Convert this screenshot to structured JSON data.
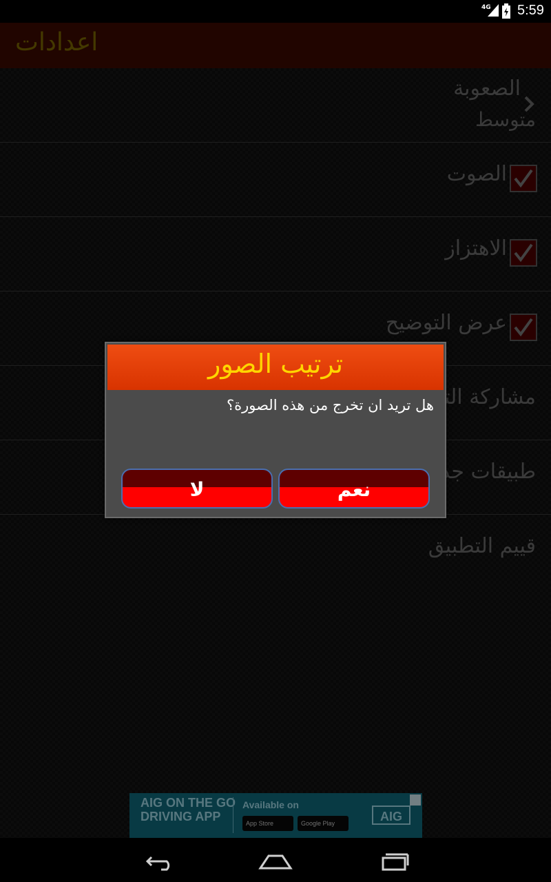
{
  "status_bar": {
    "network": "4G",
    "time": "5:59"
  },
  "app_bar": {
    "title": "اعدادات"
  },
  "settings": {
    "difficulty": {
      "label": "الصعوبة",
      "value": "متوسط"
    },
    "sound": {
      "label": "الصوت",
      "checked": true
    },
    "vibration": {
      "label": "الاهتزاز",
      "checked": true
    },
    "show_hint": {
      "label": "عرض التوضيح",
      "checked": true
    },
    "share": {
      "label": "مشاركة التطبيق"
    },
    "more_apps": {
      "label": "طبيقات جديدة"
    },
    "rate": {
      "label": "قييم التطبيق"
    }
  },
  "ad": {
    "headline": "AIG ON THE GO DRIVING APP",
    "available": "Available on",
    "app_store": "App Store",
    "google_play": "Google Play",
    "logo": "AIG"
  },
  "dialog": {
    "title": "ترتيب الصور",
    "message": "هل تريد ان تخرج من هذه الصورة؟",
    "yes_label": "نعم",
    "no_label": "لا"
  },
  "colors": {
    "dialog_header": "#e83f0a",
    "dialog_title": "#ffd600",
    "button_top": "#5e0000",
    "button_bottom": "#ff0000",
    "app_bar": "#3d0a00"
  }
}
